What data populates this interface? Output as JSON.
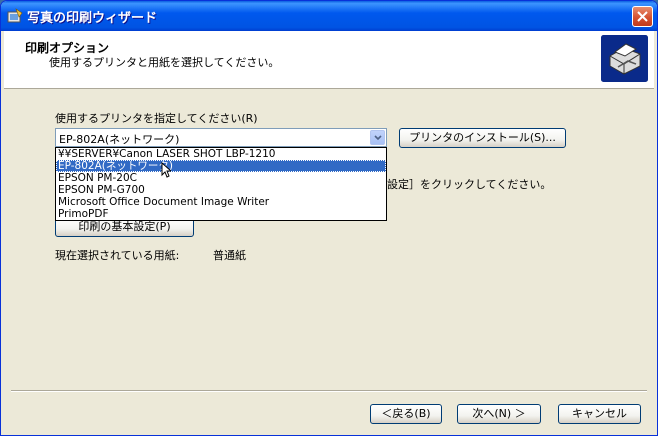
{
  "window": {
    "title": "写真の印刷ウィザード",
    "close_glyph": "✕"
  },
  "header": {
    "title": "印刷オプション",
    "subtitle": "使用するプリンタと用紙を選択してください。",
    "icon": "printer-icon"
  },
  "printer": {
    "label": "使用するプリンタを指定してください(R)",
    "selected": "EP-802A(ネットワーク)",
    "install_button": "プリンタのインストール(S)...",
    "options": [
      "¥¥SERVER¥Canon LASER SHOT LBP-1210",
      "EP-802A(ネットワーク)",
      "EPSON PM-20C",
      "EPSON PM-G700",
      "Microsoft Office Document Image Writer",
      "PrimoPDF"
    ],
    "highlighted_index": 1
  },
  "instruction_partial": "設定］をクリックしてください。",
  "basic_settings_button": "印刷の基本設定(P)",
  "paper": {
    "label": "現在選択されている用紙:",
    "value": "普通紙"
  },
  "footer": {
    "back": "＜戻る(B)",
    "next": "次へ(N) ＞",
    "cancel": "キャンセル"
  },
  "colors": {
    "titlebar": "#0054e3",
    "selection": "#316ac5",
    "window_bg": "#ece9d8"
  }
}
